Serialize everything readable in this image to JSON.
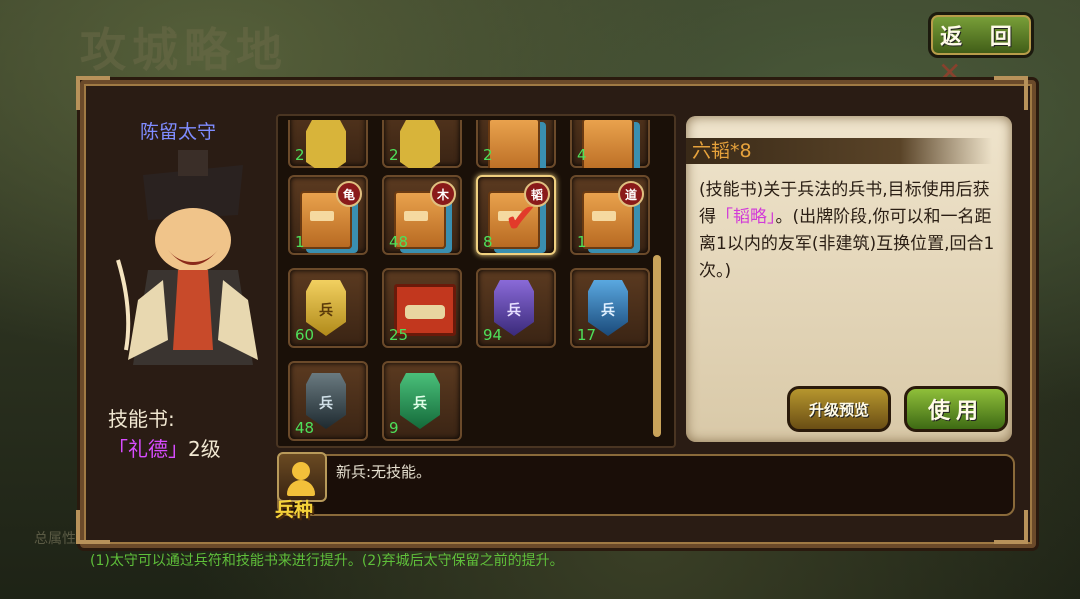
{
  "header": {
    "bg_title": "攻城略地",
    "back_label": "返 回"
  },
  "hero": {
    "name": "陈留太守",
    "skill_label": "技能书:",
    "skill_name": "「礼德」",
    "skill_level": "2级"
  },
  "inventory": {
    "row0": [
      {
        "count": "2"
      },
      {
        "count": "2"
      },
      {
        "count": "2"
      },
      {
        "count": "4"
      }
    ],
    "row1": [
      {
        "type": "book",
        "tag": "龟",
        "count": "1"
      },
      {
        "type": "book",
        "tag": "木",
        "count": "48"
      },
      {
        "type": "book",
        "tag": "韬",
        "count": "8",
        "selected": true
      },
      {
        "type": "book",
        "tag": "道",
        "count": "1"
      }
    ],
    "row2": [
      {
        "type": "token-gold",
        "glyph": "兵",
        "count": "60"
      },
      {
        "type": "chest",
        "count": "25"
      },
      {
        "type": "token-purple",
        "glyph": "兵",
        "count": "94"
      },
      {
        "type": "token-blue",
        "glyph": "兵",
        "count": "17"
      }
    ],
    "row3": [
      {
        "type": "token-dark",
        "glyph": "兵",
        "count": "48"
      },
      {
        "type": "token-green",
        "glyph": "兵",
        "count": "9"
      }
    ]
  },
  "detail": {
    "title": "六韬*8",
    "desc_pre": "(技能书)关于兵法的兵书,目标使用后获得",
    "desc_highlight": "「韬略」",
    "desc_post": "。(出牌阶段,你可以和一名距离1以内的友军(非建筑)互换位置,回合1次。)",
    "upgrade_label": "升级预览",
    "use_label": "使用"
  },
  "unit": {
    "label": "兵种",
    "text": "新兵:无技能。"
  },
  "footer": {
    "note": "(1)太守可以通过兵符和技能书来进行提升。(2)弃城后太守保留之前的提升。",
    "faint": "总属性"
  },
  "colors": {
    "accent_green": "#5fbf3a",
    "hero_name": "#7f8cff",
    "highlight": "#d23ad8",
    "title_orange": "#e6a23c"
  }
}
